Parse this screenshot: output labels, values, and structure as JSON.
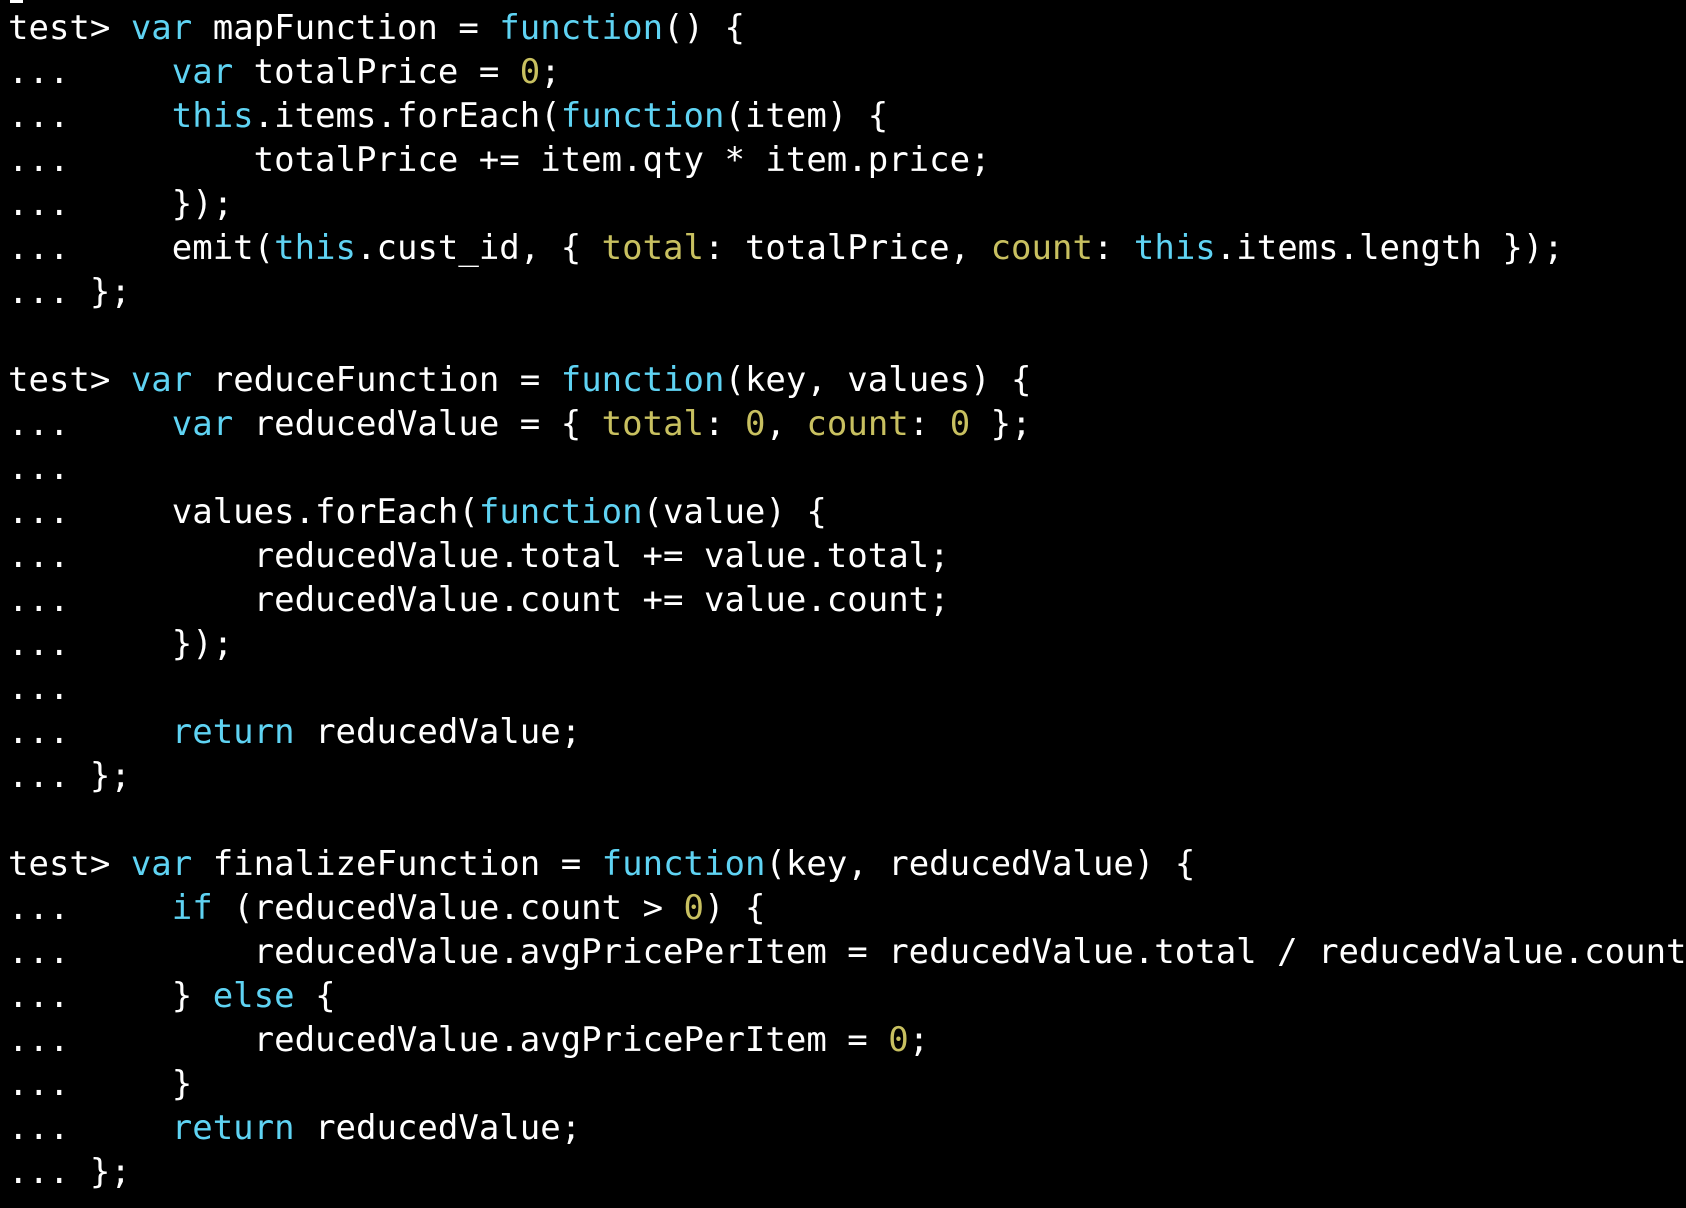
{
  "palette": {
    "background": "#000000",
    "default": "#ffffff",
    "keyword": "#5fd3f3",
    "number": "#c8c060",
    "property": "#c8c060"
  },
  "terminal": {
    "lines": [
      [
        [
          "default",
          "test> "
        ],
        [
          "keyword",
          "var"
        ],
        [
          "default",
          " mapFunction = "
        ],
        [
          "keyword",
          "function"
        ],
        [
          "default",
          "() {"
        ]
      ],
      [
        [
          "default",
          "...     "
        ],
        [
          "keyword",
          "var"
        ],
        [
          "default",
          " totalPrice = "
        ],
        [
          "number",
          "0"
        ],
        [
          "default",
          ";"
        ]
      ],
      [
        [
          "default",
          "...     "
        ],
        [
          "keyword",
          "this"
        ],
        [
          "default",
          ".items.forEach("
        ],
        [
          "keyword",
          "function"
        ],
        [
          "default",
          "(item) {"
        ]
      ],
      [
        [
          "default",
          "...         totalPrice += item.qty * item.price;"
        ]
      ],
      [
        [
          "default",
          "...     });"
        ]
      ],
      [
        [
          "default",
          "...     emit("
        ],
        [
          "keyword",
          "this"
        ],
        [
          "default",
          ".cust_id, { "
        ],
        [
          "prop",
          "total"
        ],
        [
          "default",
          ": totalPrice, "
        ],
        [
          "prop",
          "count"
        ],
        [
          "default",
          ": "
        ],
        [
          "keyword",
          "this"
        ],
        [
          "default",
          ".items.length });"
        ]
      ],
      [
        [
          "default",
          "... };"
        ]
      ],
      [
        [
          "default",
          ""
        ]
      ],
      [
        [
          "default",
          "test> "
        ],
        [
          "keyword",
          "var"
        ],
        [
          "default",
          " reduceFunction = "
        ],
        [
          "keyword",
          "function"
        ],
        [
          "default",
          "(key, values) {"
        ]
      ],
      [
        [
          "default",
          "...     "
        ],
        [
          "keyword",
          "var"
        ],
        [
          "default",
          " reducedValue = { "
        ],
        [
          "prop",
          "total"
        ],
        [
          "default",
          ": "
        ],
        [
          "number",
          "0"
        ],
        [
          "default",
          ", "
        ],
        [
          "prop",
          "count"
        ],
        [
          "default",
          ": "
        ],
        [
          "number",
          "0"
        ],
        [
          "default",
          " };"
        ]
      ],
      [
        [
          "default",
          "..."
        ]
      ],
      [
        [
          "default",
          "...     values.forEach("
        ],
        [
          "keyword",
          "function"
        ],
        [
          "default",
          "(value) {"
        ]
      ],
      [
        [
          "default",
          "...         reducedValue.total += value.total;"
        ]
      ],
      [
        [
          "default",
          "...         reducedValue.count += value.count;"
        ]
      ],
      [
        [
          "default",
          "...     });"
        ]
      ],
      [
        [
          "default",
          "..."
        ]
      ],
      [
        [
          "default",
          "...     "
        ],
        [
          "keyword",
          "return"
        ],
        [
          "default",
          " reducedValue;"
        ]
      ],
      [
        [
          "default",
          "... };"
        ]
      ],
      [
        [
          "default",
          ""
        ]
      ],
      [
        [
          "default",
          "test> "
        ],
        [
          "keyword",
          "var"
        ],
        [
          "default",
          " finalizeFunction = "
        ],
        [
          "keyword",
          "function"
        ],
        [
          "default",
          "(key, reducedValue) {"
        ]
      ],
      [
        [
          "default",
          "...     "
        ],
        [
          "keyword",
          "if"
        ],
        [
          "default",
          " (reducedValue.count > "
        ],
        [
          "number",
          "0"
        ],
        [
          "default",
          ") {"
        ]
      ],
      [
        [
          "default",
          "...         reducedValue.avgPricePerItem = reducedValue.total / reducedValue.count;"
        ]
      ],
      [
        [
          "default",
          "...     } "
        ],
        [
          "keyword",
          "else"
        ],
        [
          "default",
          " {"
        ]
      ],
      [
        [
          "default",
          "...         reducedValue.avgPricePerItem = "
        ],
        [
          "number",
          "0"
        ],
        [
          "default",
          ";"
        ]
      ],
      [
        [
          "default",
          "...     }"
        ]
      ],
      [
        [
          "default",
          "...     "
        ],
        [
          "keyword",
          "return"
        ],
        [
          "default",
          " reducedValue;"
        ]
      ],
      [
        [
          "default",
          "... };"
        ]
      ]
    ]
  }
}
